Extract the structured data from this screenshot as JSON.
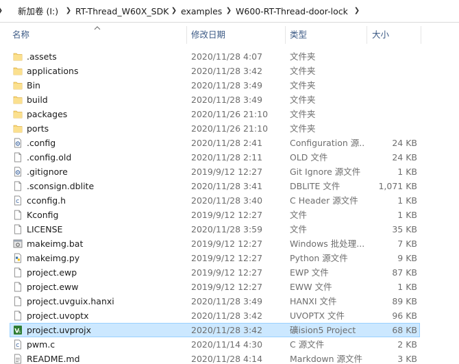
{
  "breadcrumb": [
    {
      "label": "新加卷 (I:)"
    },
    {
      "label": "RT-Thread_W60X_SDK"
    },
    {
      "label": "examples"
    },
    {
      "label": "W600-RT-Thread-door-lock"
    }
  ],
  "columns": {
    "name": "名称",
    "date": "修改日期",
    "type": "类型",
    "size": "大小"
  },
  "colors": {
    "selection": "#cce8ff",
    "selection_border": "#99d1ff",
    "folder": "#f8d775",
    "header_text": "#3c5a85"
  },
  "files": [
    {
      "name": ".assets",
      "date": "2020/11/28 4:07",
      "type": "文件夹",
      "size": "",
      "icon": "folder-icon"
    },
    {
      "name": "applications",
      "date": "2020/11/28 3:42",
      "type": "文件夹",
      "size": "",
      "icon": "folder-icon"
    },
    {
      "name": "Bin",
      "date": "2020/11/28 3:49",
      "type": "文件夹",
      "size": "",
      "icon": "folder-icon"
    },
    {
      "name": "build",
      "date": "2020/11/28 3:49",
      "type": "文件夹",
      "size": "",
      "icon": "folder-icon"
    },
    {
      "name": "packages",
      "date": "2020/11/26 21:10",
      "type": "文件夹",
      "size": "",
      "icon": "folder-icon"
    },
    {
      "name": "ports",
      "date": "2020/11/26 21:10",
      "type": "文件夹",
      "size": "",
      "icon": "folder-icon"
    },
    {
      "name": ".config",
      "date": "2020/11/28 2:41",
      "type": "Configuration 源...",
      "size": "24 KB",
      "icon": "config-file-icon"
    },
    {
      "name": ".config.old",
      "date": "2020/11/28 2:11",
      "type": "OLD 文件",
      "size": "24 KB",
      "icon": "file-icon"
    },
    {
      "name": ".gitignore",
      "date": "2019/9/12 12:27",
      "type": "Git Ignore 源文件",
      "size": "1 KB",
      "icon": "config-file-icon"
    },
    {
      "name": ".sconsign.dblite",
      "date": "2020/11/28 3:41",
      "type": "DBLITE 文件",
      "size": "1,071 KB",
      "icon": "file-icon"
    },
    {
      "name": "cconfig.h",
      "date": "2020/11/28 3:40",
      "type": "C Header 源文件",
      "size": "1 KB",
      "icon": "c-header-icon"
    },
    {
      "name": "Kconfig",
      "date": "2019/9/12 12:27",
      "type": "文件",
      "size": "1 KB",
      "icon": "file-icon"
    },
    {
      "name": "LICENSE",
      "date": "2020/11/28 3:59",
      "type": "文件",
      "size": "35 KB",
      "icon": "file-icon"
    },
    {
      "name": "makeimg.bat",
      "date": "2019/9/12 12:27",
      "type": "Windows 批处理...",
      "size": "7 KB",
      "icon": "batch-file-icon"
    },
    {
      "name": "makeimg.py",
      "date": "2019/9/12 12:27",
      "type": "Python 源文件",
      "size": "9 KB",
      "icon": "python-file-icon"
    },
    {
      "name": "project.ewp",
      "date": "2019/9/12 12:27",
      "type": "EWP 文件",
      "size": "87 KB",
      "icon": "file-icon"
    },
    {
      "name": "project.eww",
      "date": "2019/9/12 12:27",
      "type": "EWW 文件",
      "size": "1 KB",
      "icon": "file-icon"
    },
    {
      "name": "project.uvguix.hanxi",
      "date": "2020/11/28 3:49",
      "type": "HANXI 文件",
      "size": "89 KB",
      "icon": "file-icon"
    },
    {
      "name": "project.uvoptx",
      "date": "2020/11/28 3:42",
      "type": "UVOPTX 文件",
      "size": "96 KB",
      "icon": "file-icon"
    },
    {
      "name": "project.uvprojx",
      "date": "2020/11/28 3:42",
      "type": "礦ision5 Project",
      "size": "68 KB",
      "icon": "keil-project-icon",
      "selected": true
    },
    {
      "name": "pwm.c",
      "date": "2020/11/14 4:30",
      "type": "C 源文件",
      "size": "2 KB",
      "icon": "c-source-icon"
    },
    {
      "name": "README.md",
      "date": "2020/11/28 4:14",
      "type": "Markdown 源文件",
      "size": "3 KB",
      "icon": "markdown-file-icon"
    }
  ]
}
